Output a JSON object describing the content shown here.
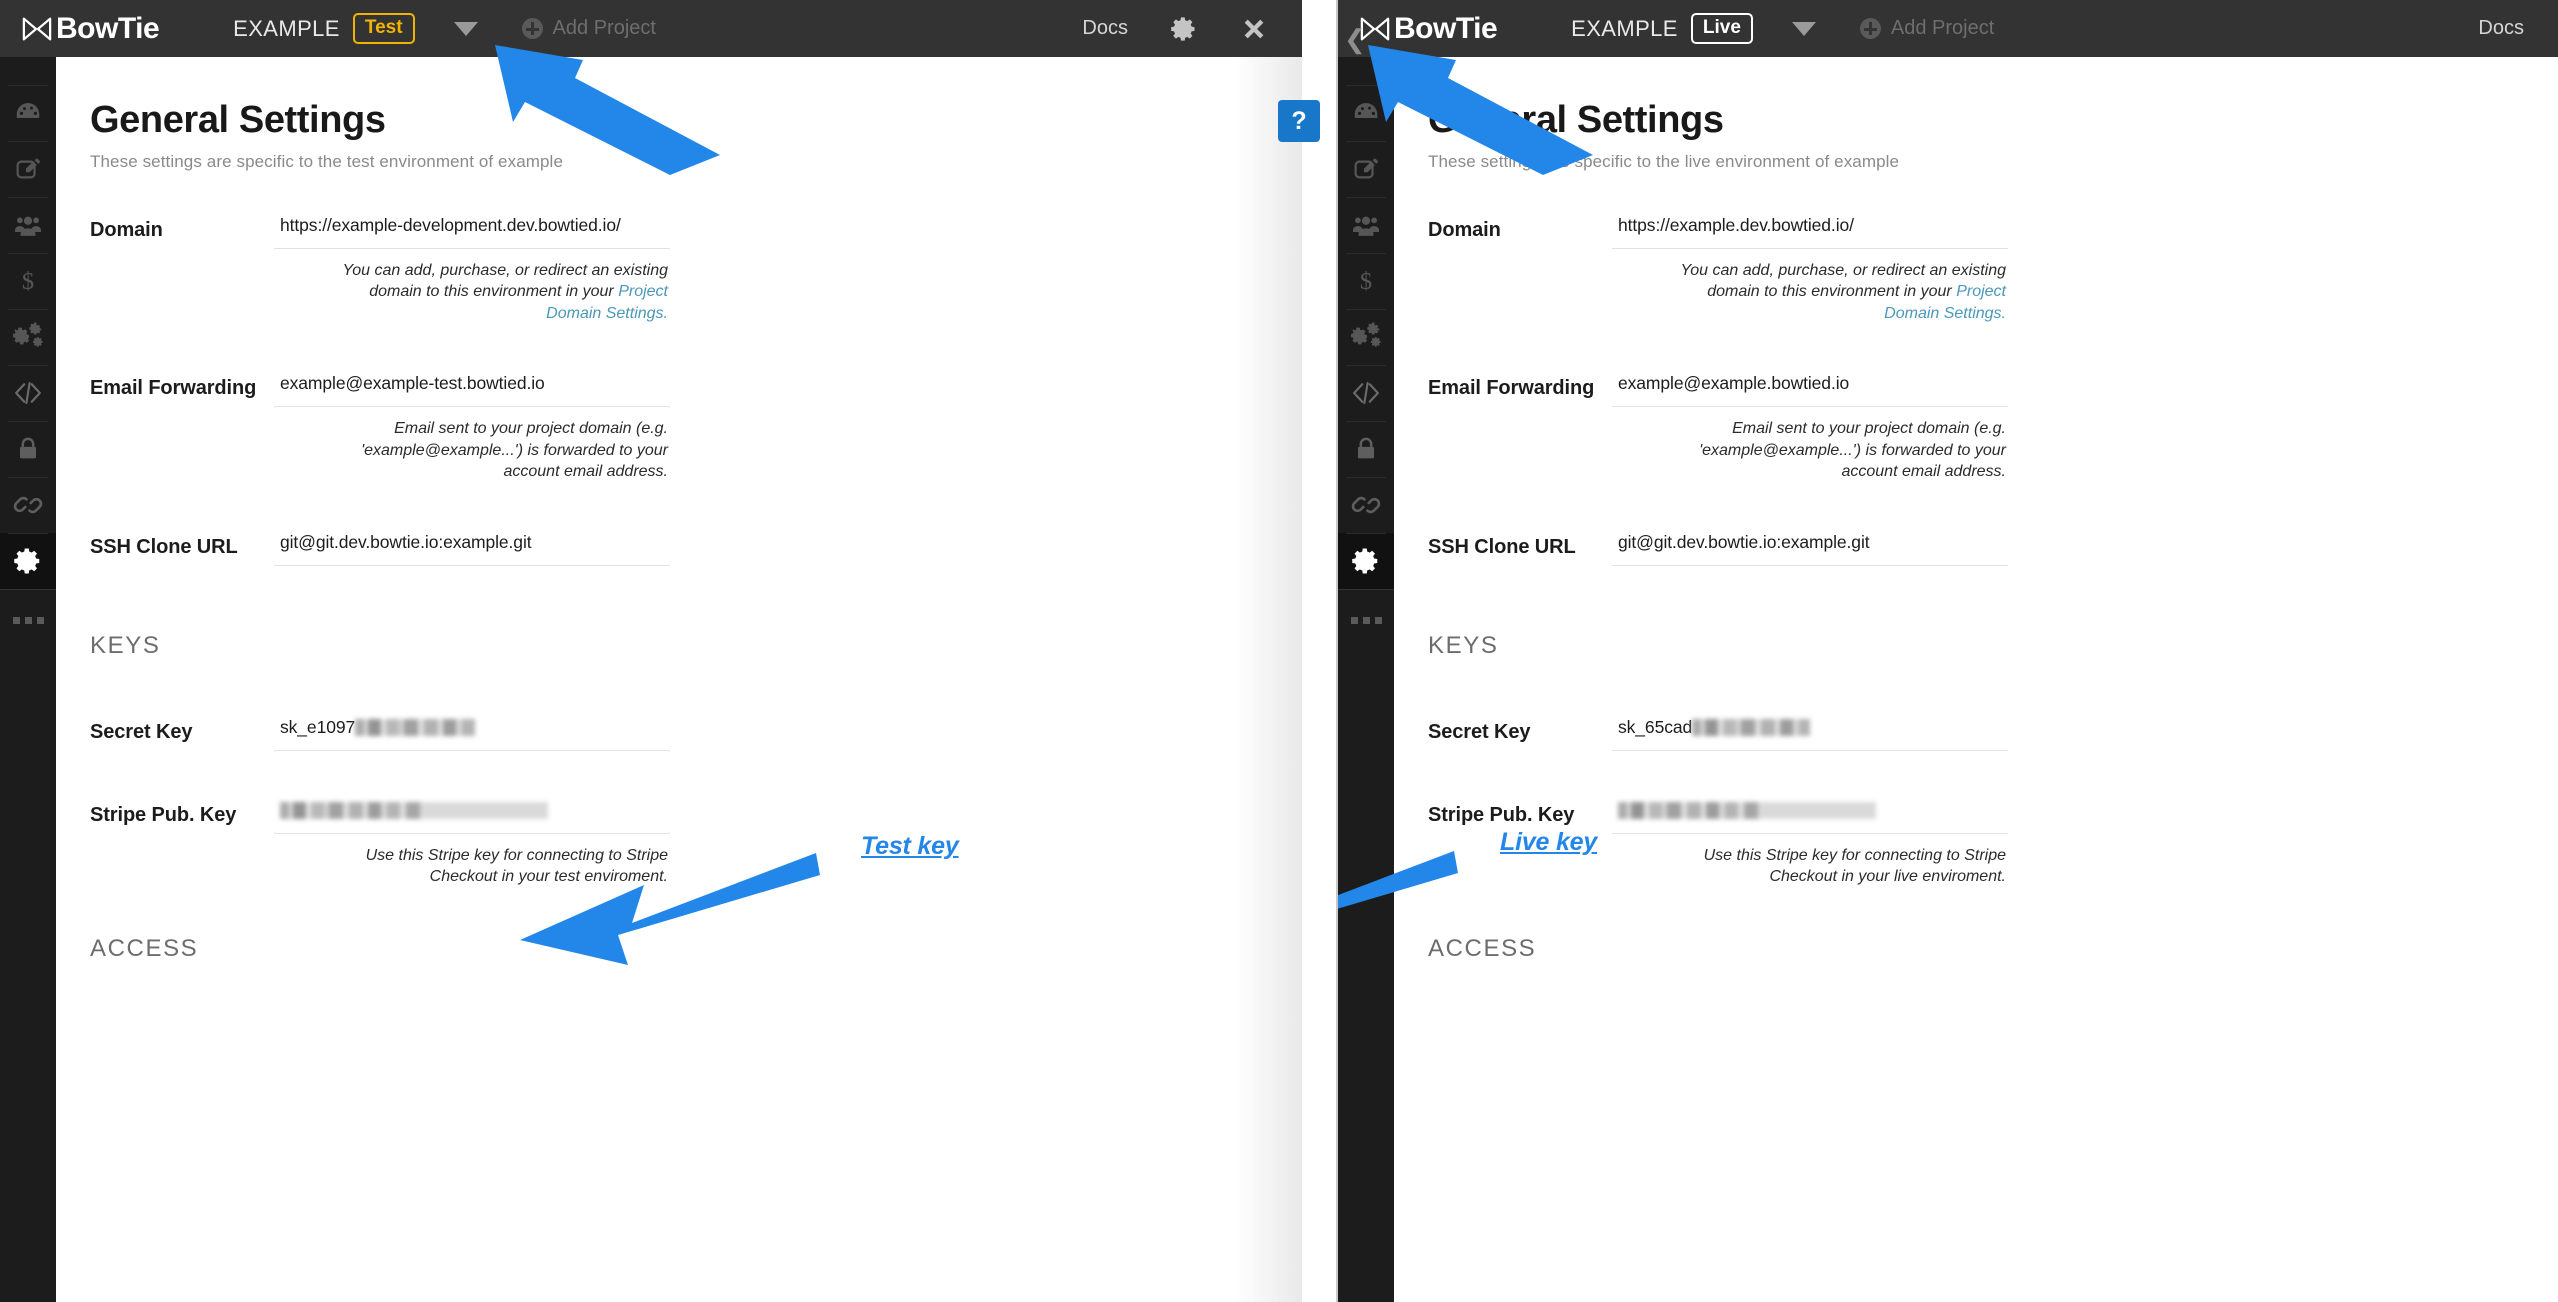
{
  "brand": {
    "name": "BowTie",
    "logo_icon": "bowtie-logo-icon"
  },
  "panels": [
    {
      "id": "test",
      "topbar": {
        "project_name": "EXAMPLE",
        "env_badge": "Test",
        "env_badge_color": "#f0b400",
        "dropdown_icon": "chevron-down-icon",
        "add_project_label": "Add Project",
        "add_project_icon": "plus-circle-icon",
        "docs_label": "Docs",
        "settings_icon": "gear-icon",
        "close_icon": "close-icon",
        "show_right_controls": true
      },
      "title": "General Settings",
      "subtitle": "These settings are specific to the test environment of example",
      "rows": [
        {
          "label": "Domain",
          "value": "https://example-development.dev.bowtied.io/",
          "help_prefix": "You can add, purchase, or redirect an existing domain to this environment in your ",
          "help_link": "Project Domain Settings."
        },
        {
          "label": "Email Forwarding",
          "value": "example@example-test.bowtied.io",
          "help_prefix": "Email sent to your project domain (e.g. 'example@example...') is forwarded to your account email address.",
          "help_link": ""
        },
        {
          "label": "SSH Clone URL",
          "value": "git@git.dev.bowtie.io:example.git",
          "help_prefix": "",
          "help_link": ""
        }
      ],
      "keys_section": "KEYS",
      "keys": [
        {
          "label": "Secret Key",
          "value_prefix": "sk_e1097",
          "redacted": true,
          "redact_width": 120,
          "help_prefix": "",
          "help_link": ""
        },
        {
          "label": "Stripe Pub. Key",
          "value_prefix": "",
          "redacted": true,
          "redact_width": 268,
          "help_prefix": "Use this Stripe key for connecting to Stripe Checkout in your test enviroment.",
          "help_link": ""
        }
      ],
      "access_section": "ACCESS",
      "annotation": {
        "label": "Test key",
        "color": "#2287e8"
      }
    },
    {
      "id": "live",
      "topbar": {
        "project_name": "EXAMPLE",
        "env_badge": "Live",
        "env_badge_color": "#ffffff",
        "dropdown_icon": "chevron-down-icon",
        "add_project_label": "Add Project",
        "add_project_icon": "plus-circle-icon",
        "docs_label": "Docs",
        "settings_icon": "gear-icon",
        "close_icon": "close-icon",
        "show_right_controls": false
      },
      "title": "General Settings",
      "subtitle": "These settings are specific to the live environment of example",
      "rows": [
        {
          "label": "Domain",
          "value": "https://example.dev.bowtied.io/",
          "help_prefix": "You can add, purchase, or redirect an existing domain to this environment in your ",
          "help_link": "Project Domain Settings."
        },
        {
          "label": "Email Forwarding",
          "value": "example@example.bowtied.io",
          "help_prefix": "Email sent to your project domain (e.g. 'example@example...') is forwarded to your account email address.",
          "help_link": ""
        },
        {
          "label": "SSH Clone URL",
          "value": "git@git.dev.bowtie.io:example.git",
          "help_prefix": "",
          "help_link": ""
        }
      ],
      "keys_section": "KEYS",
      "keys": [
        {
          "label": "Secret Key",
          "value_prefix": "sk_65cad",
          "redacted": true,
          "redact_width": 118,
          "help_prefix": "",
          "help_link": ""
        },
        {
          "label": "Stripe Pub. Key",
          "value_prefix": "",
          "redacted": true,
          "redact_width": 258,
          "help_prefix": "Use this Stripe key for connecting to Stripe Checkout in your live enviroment.",
          "help_link": ""
        }
      ],
      "access_section": "ACCESS",
      "annotation": {
        "label": "Live key",
        "color": "#2287e8"
      }
    }
  ],
  "sidebar": {
    "items": [
      {
        "icon": "dashboard-gauge-icon",
        "active": false
      },
      {
        "icon": "edit-pencil-icon",
        "active": false
      },
      {
        "icon": "users-group-icon",
        "active": false
      },
      {
        "icon": "dollar-sign-icon",
        "active": false
      },
      {
        "icon": "gears-icon",
        "active": false
      },
      {
        "icon": "code-brackets-icon",
        "active": false
      },
      {
        "icon": "lock-icon",
        "active": false
      },
      {
        "icon": "link-chain-icon",
        "active": false
      },
      {
        "icon": "gear-icon",
        "active": true
      }
    ],
    "more_icon": "ellipsis-icon"
  },
  "help_bubble": {
    "glyph": "?",
    "color": "#1877c9"
  }
}
